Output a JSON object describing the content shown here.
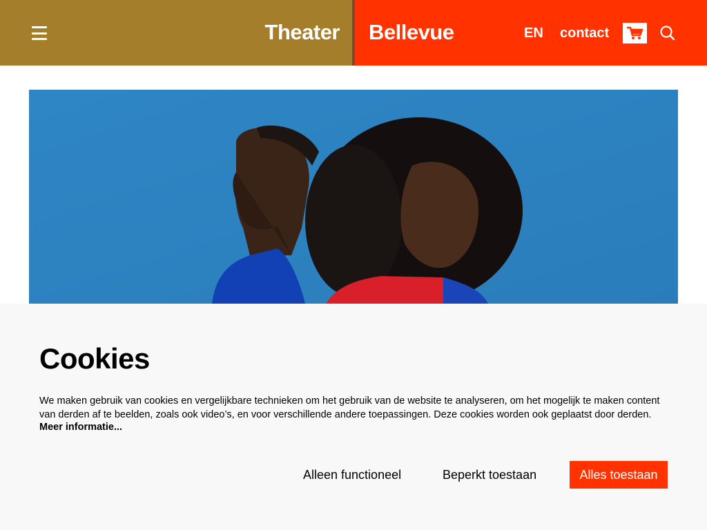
{
  "header": {
    "menu_icon": "hamburger-menu-icon",
    "brand_left": "Theater",
    "brand_right": "Bellevue",
    "language_link": "EN",
    "contact_link": "contact",
    "cart_icon": "shopping-cart-icon",
    "search_icon": "search-icon",
    "colors": {
      "left": "#a57e2c",
      "right": "#ff3200"
    }
  },
  "hero": {
    "image": "photo of two performers back to back against blue background",
    "background": "#2f86c4"
  },
  "cookie_banner": {
    "title": "Cookies",
    "text": "We maken gebruik van cookies en vergelijkbare technieken om het gebruik van de website te analyseren, om het mogelijk te maken content van derden af te beelden, zoals ook video’s, en voor verschillende andere toepassingen. Deze cookies worden ook geplaatst door derden.",
    "more_link": "Meer informatie...",
    "buttons": {
      "functional": "Alleen functioneel",
      "limited": "Beperkt toestaan",
      "all": "Alles toestaan"
    },
    "accent": "#ff3200"
  }
}
